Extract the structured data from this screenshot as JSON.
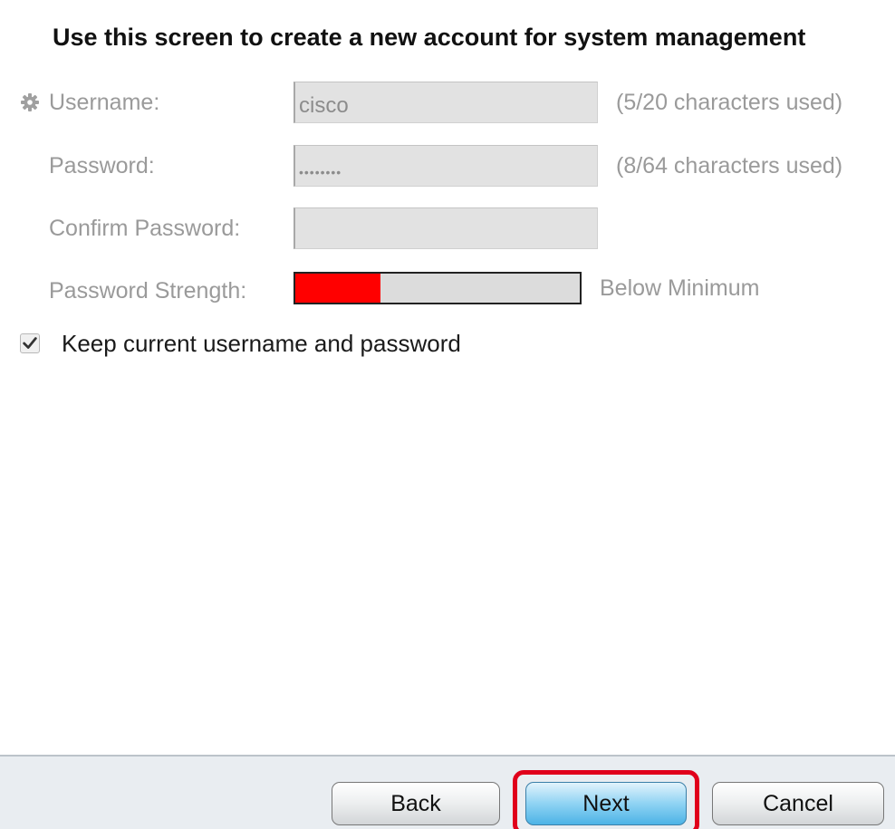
{
  "heading": "Use this screen to create a new account for system management",
  "form": {
    "username": {
      "label": "Username:",
      "value": "cisco",
      "hint": "(5/20 characters used)",
      "icon": "gear-icon"
    },
    "password": {
      "label": "Password:",
      "value": "cisco123",
      "hint": "(8/64 characters used)"
    },
    "confirm_password": {
      "label": "Confirm Password:",
      "value": ""
    },
    "password_strength": {
      "label": "Password Strength:",
      "level_fraction": 0.3,
      "status": "Below Minimum",
      "fill_color": "#ff0000"
    }
  },
  "keep_current": {
    "label": "Keep current username and password",
    "checked": true
  },
  "footer": {
    "back_label": "Back",
    "next_label": "Next",
    "cancel_label": "Cancel",
    "highlight_color": "#e0001b"
  }
}
